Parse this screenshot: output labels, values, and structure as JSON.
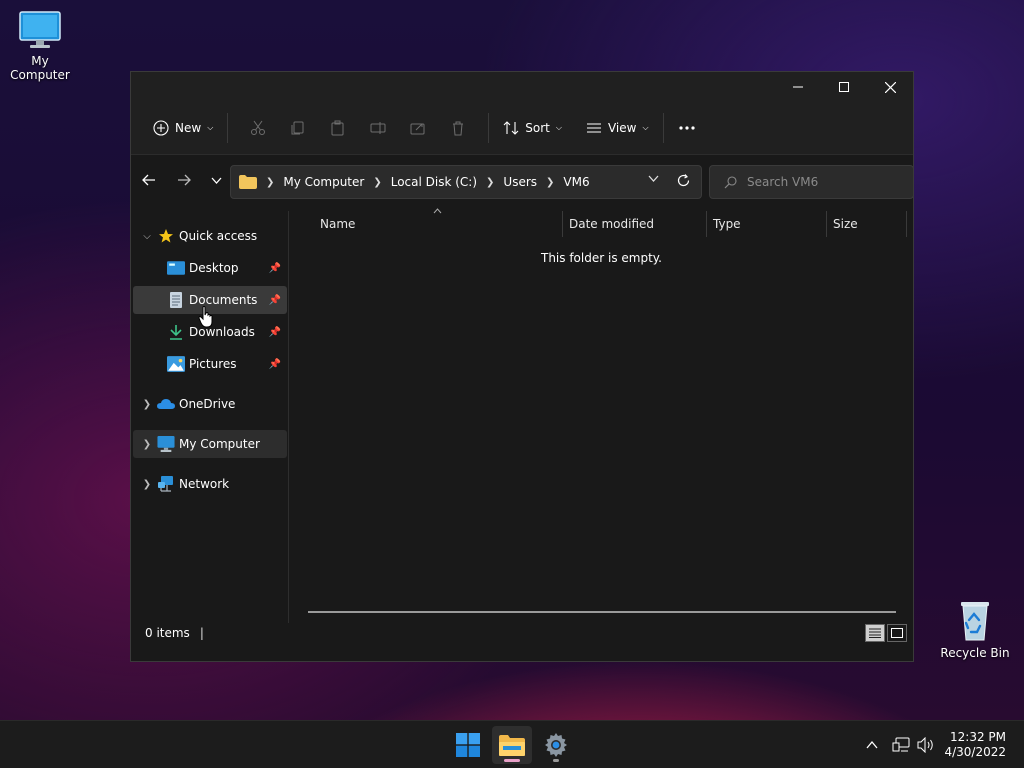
{
  "desktop": {
    "icons": [
      {
        "label": "My Computer",
        "icon": "monitor-icon"
      },
      {
        "label": "Recycle Bin",
        "icon": "recycle-bin-icon"
      }
    ]
  },
  "window": {
    "title_buttons": {
      "minimize": "minimize-icon",
      "maximize": "maximize-icon",
      "close": "close-icon"
    },
    "toolbar": {
      "new_label": "New",
      "sort_label": "Sort",
      "view_label": "View",
      "disabled_actions": [
        "cut-icon",
        "copy-icon",
        "paste-icon",
        "rename-icon",
        "share-icon",
        "delete-icon"
      ],
      "more_icon": "more-icon"
    },
    "address": {
      "breadcrumbs": [
        "My Computer",
        "Local Disk (C:)",
        "Users",
        "VM6"
      ],
      "search_placeholder": "Search VM6"
    },
    "sidebar": {
      "quick_access": "Quick access",
      "pinned": [
        {
          "label": "Desktop",
          "icon": "desktop-folder-icon"
        },
        {
          "label": "Documents",
          "icon": "documents-folder-icon"
        },
        {
          "label": "Downloads",
          "icon": "downloads-folder-icon"
        },
        {
          "label": "Pictures",
          "icon": "pictures-folder-icon"
        }
      ],
      "roots": [
        {
          "label": "OneDrive",
          "icon": "onedrive-icon"
        },
        {
          "label": "My Computer",
          "icon": "computer-icon"
        },
        {
          "label": "Network",
          "icon": "network-icon"
        }
      ]
    },
    "columns": [
      "Name",
      "Date modified",
      "Type",
      "Size"
    ],
    "empty_message": "This folder is empty.",
    "status": {
      "item_count": "0 items"
    }
  },
  "taskbar": {
    "apps": [
      "start-icon",
      "file-explorer-icon",
      "settings-icon"
    ],
    "clock": {
      "time": "12:32 PM",
      "date": "4/30/2022"
    }
  },
  "colors": {
    "accent": "#0078d4",
    "window_bg": "#191919",
    "explorer_indicator": "#e8a0c8",
    "folder": "#f2c55c"
  }
}
